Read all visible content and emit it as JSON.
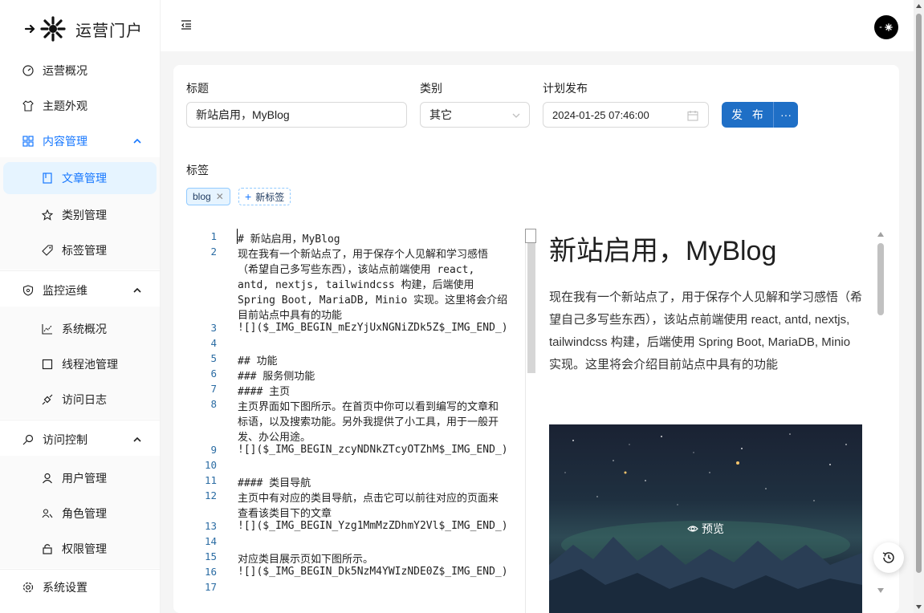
{
  "brand": {
    "name": "运营门户"
  },
  "sidebar": {
    "items": [
      {
        "label": "运营概况",
        "icon": "dashboard-icon"
      },
      {
        "label": "主题外观",
        "icon": "shirt-icon"
      },
      {
        "label": "内容管理",
        "icon": "appstore-icon",
        "expanded": true,
        "children": [
          {
            "label": "文章管理",
            "icon": "book-icon",
            "selected": true
          },
          {
            "label": "类别管理",
            "icon": "star-icon"
          },
          {
            "label": "标签管理",
            "icon": "tag-icon"
          }
        ]
      },
      {
        "label": "监控运维",
        "icon": "shield-icon",
        "expanded": true,
        "children": [
          {
            "label": "系统概况",
            "icon": "chart-icon"
          },
          {
            "label": "线程池管理",
            "icon": "square-icon"
          },
          {
            "label": "访问日志",
            "icon": "api-icon"
          }
        ]
      },
      {
        "label": "访问控制",
        "icon": "key-icon",
        "expanded": true,
        "children": [
          {
            "label": "用户管理",
            "icon": "user-icon"
          },
          {
            "label": "角色管理",
            "icon": "team-icon"
          },
          {
            "label": "权限管理",
            "icon": "lock-icon"
          }
        ]
      },
      {
        "label": "系统设置",
        "icon": "setting-icon"
      }
    ]
  },
  "form": {
    "title_label": "标题",
    "title_value": "新站启用，MyBlog",
    "category_label": "类别",
    "category_value": "其它",
    "schedule_label": "计划发布",
    "schedule_value": "2024-01-25 07:46:00",
    "publish_label": "发 布",
    "more_label": "···",
    "tags_label": "标签",
    "tags": [
      "blog"
    ],
    "new_tag_label": "新标签"
  },
  "editor": {
    "lines": [
      {
        "n": "1",
        "rows": [
          "# 新站启用，MyBlog"
        ]
      },
      {
        "n": "2",
        "rows": [
          "现在我有一个新站点了，用于保存个人见解和学习感悟",
          "（希望自己多写些东西），该站点前端使用 react,",
          "antd, nextjs, tailwindcss 构建，后端使用",
          "Spring Boot, MariaDB, Minio 实现。这里将会介绍",
          "目前站点中具有的功能"
        ]
      },
      {
        "n": "3",
        "rows": [
          "![]($_IMG_BEGIN_mEzYjUxNGNiZDk5Z$_IMG_END_)"
        ]
      },
      {
        "n": "4",
        "rows": [
          ""
        ]
      },
      {
        "n": "5",
        "rows": [
          "## 功能"
        ]
      },
      {
        "n": "6",
        "rows": [
          "### 服务侧功能"
        ]
      },
      {
        "n": "7",
        "rows": [
          "#### 主页"
        ]
      },
      {
        "n": "8",
        "rows": [
          "主页界面如下图所示。在首页中你可以看到编写的文章和",
          "标语，以及搜索功能。另外我提供了小工具，用于一般开",
          "发、办公用途。"
        ]
      },
      {
        "n": "9",
        "rows": [
          "![]($_IMG_BEGIN_zcyNDNkZTcyOTZhM$_IMG_END_)"
        ]
      },
      {
        "n": "10",
        "rows": [
          ""
        ]
      },
      {
        "n": "11",
        "rows": [
          "#### 类目导航"
        ]
      },
      {
        "n": "12",
        "rows": [
          "主页中有对应的类目导航，点击它可以前往对应的页面来",
          "查看该类目下的文章"
        ]
      },
      {
        "n": "13",
        "rows": [
          "![]($_IMG_BEGIN_Yzg1MmMzZDhmY2Vl$_IMG_END_)"
        ]
      },
      {
        "n": "14",
        "rows": [
          ""
        ]
      },
      {
        "n": "15",
        "rows": [
          "对应类目展示页如下图所示。"
        ]
      },
      {
        "n": "16",
        "rows": [
          "![]($_IMG_BEGIN_Dk5NzM4YWIzNDE0Z$_IMG_END_)"
        ]
      },
      {
        "n": "17",
        "rows": [
          ""
        ]
      }
    ]
  },
  "preview": {
    "title": "新站启用，MyBlog",
    "paragraph": "现在我有一个新站点了，用于保存个人见解和学习感悟（希望自己多写些东西），该站点前端使用 react, antd, nextjs, tailwindcss 构建，后端使用 Spring Boot, MariaDB, Minio 实现。这里将会介绍目前站点中具有的功能",
    "image_overlay_label": "预览"
  },
  "colors": {
    "primary": "#1677ff",
    "publish": "#1f6fc6",
    "selected_bg": "#e6f4ff"
  }
}
